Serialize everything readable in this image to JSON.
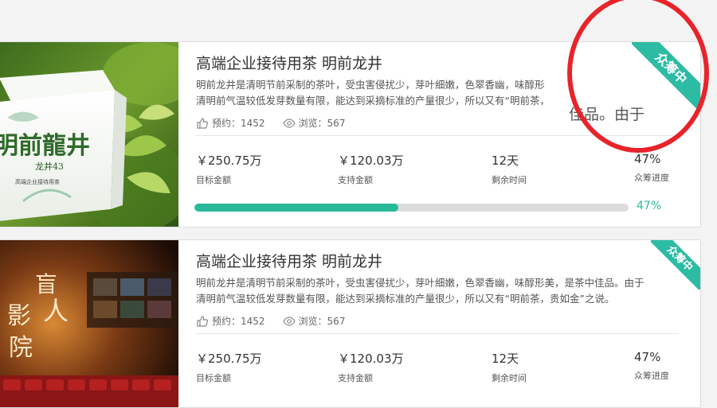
{
  "projects": [
    {
      "title": "高端企业接待用茶 明前龙井",
      "description": "明前龙井是清明节前采制的茶叶，受虫害侵扰少，芽叶细嫩，色翠香幽，味醇形美，是茶中佳品。由于清明前气温较低发芽数量有限，能达到采摘标准的产量很少，所以又有“明前茶，贵如金”之说。",
      "description_line1": "明前龙井是清明节前采制的茶叶，受虫害侵扰少，芽叶细嫩，色翠香幽，味醇形",
      "description_line2": "清明前气温较低发芽数量有限，能达到采摘标准的产量很少，所以又有“明前茶，",
      "likes": "预约：1452",
      "views": "浏览：567",
      "target_amount": "￥250.75万",
      "target_label": "目标金额",
      "support_amount": "￥120.03万",
      "support_label": "支持金额",
      "days_left": "12天",
      "days_label": "剩余时间",
      "progress": "47%",
      "progress_label": "众筹进度",
      "progress_value": 0.47,
      "badge": "众筹中",
      "zoom_text": "佳品。由于",
      "image_text": {
        "brand": "明前龍井",
        "sub": "龙井43",
        "caption": "高端企业接待用茶"
      }
    },
    {
      "title": "高端企业接待用茶 明前龙井",
      "description_line1": "明前龙井是清明节前采制的茶叶，受虫害侵扰少，芽叶细嫩，色翠香幽，味醇形美，是茶中佳品。由于",
      "description_line2": "清明前气温较低发芽数量有限，能达到采摘标准的产量很少，所以又有“明前茶，贵如金”之说。",
      "likes": "预约：1452",
      "views": "浏览：567",
      "target_amount": "￥250.75万",
      "target_label": "目标金额",
      "support_amount": "￥120.03万",
      "support_label": "支持金额",
      "days_left": "12天",
      "days_label": "剩余时间",
      "progress": "47%",
      "progress_label": "众筹进度",
      "badge": "众筹中",
      "image_text": {
        "title1": "盲",
        "title2": "人",
        "title3": "影",
        "title4": "院"
      }
    }
  ],
  "colors": {
    "accent": "#27b99a",
    "ribbon": "#2cbba3",
    "annotation": "#e8242b"
  }
}
